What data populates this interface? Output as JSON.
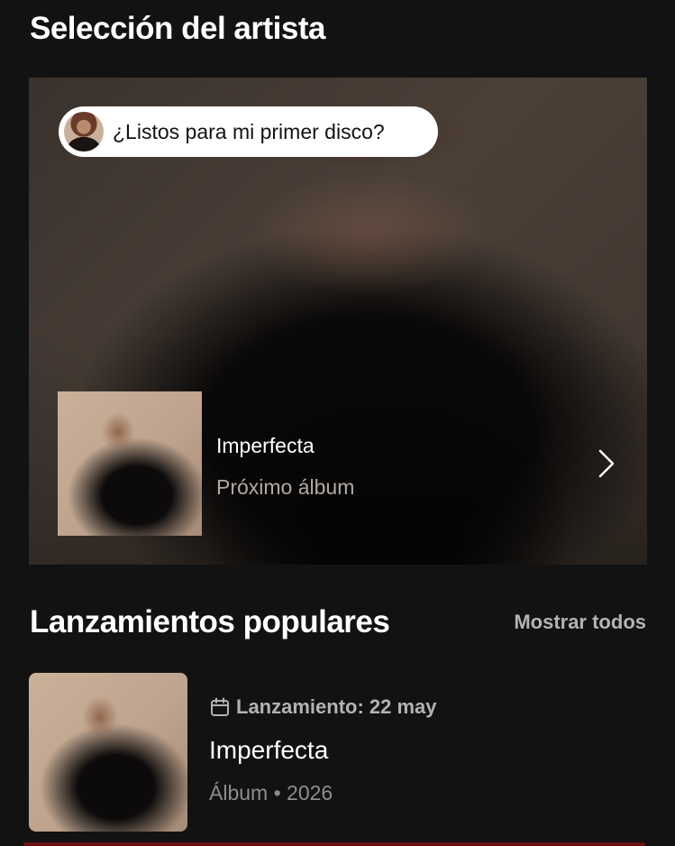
{
  "artist_pick": {
    "section_title": "Selección del artista",
    "comment": "¿Listos para mi primer disco?",
    "release": {
      "title": "Imperfecta",
      "subtitle": "Próximo álbum"
    }
  },
  "popular_releases": {
    "section_title": "Lanzamientos populares",
    "show_all_label": "Mostrar todos",
    "items": [
      {
        "date_label": "Lanzamiento: 22 may",
        "title": "Imperfecta",
        "meta": "Álbum • 2026"
      }
    ]
  },
  "icons": {
    "chevron": "chevron-right-icon",
    "calendar": "calendar-icon"
  },
  "colors": {
    "background": "#121212",
    "text_primary": "#ffffff",
    "text_secondary": "#b3b3b3",
    "bubble_bg": "#ffffff"
  }
}
